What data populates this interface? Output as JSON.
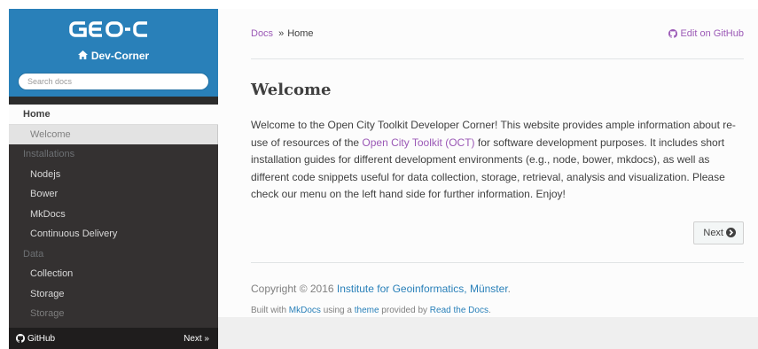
{
  "sidebar": {
    "logo_text": "GEO-C",
    "subtitle": "Dev-Corner",
    "search_placeholder": "Search docs",
    "items": [
      {
        "label": "Home"
      },
      {
        "label": "Welcome"
      },
      {
        "label": "Installations"
      },
      {
        "label": "Nodejs"
      },
      {
        "label": "Bower"
      },
      {
        "label": "MkDocs"
      },
      {
        "label": "Continuous Delivery"
      },
      {
        "label": "Data"
      },
      {
        "label": "Collection"
      },
      {
        "label": "Storage"
      },
      {
        "label": "Storage"
      }
    ],
    "footer": {
      "github_label": "GitHub",
      "next_label": "Next »"
    }
  },
  "breadcrumb": {
    "docs_label": "Docs",
    "separator": "»",
    "current": "Home",
    "edit_label": "Edit on GitHub"
  },
  "main": {
    "title": "Welcome",
    "para_1": "Welcome to the Open City Toolkit Developer Corner! This website provides ample information about re-use of resources of the ",
    "para_link": "Open City Toolkit (OCT)",
    "para_2": " for software development purposes. It includes short installation guides for different development environments (e.g., node, bower, mkdocs), as well as different code snippets useful for data collection, storage, retrieval, analysis and visualization. Please check our menu on the left hand side for further information. Enjoy!",
    "next_button": "Next"
  },
  "footer": {
    "copyright": "Copyright © 2016 ",
    "institute_link": "Institute for Geoinformatics, Münster",
    "period": ".",
    "built_1": "Built with ",
    "mkdocs_link": "MkDocs",
    "built_2": " using a ",
    "theme_link": "theme",
    "built_3": " provided by ",
    "rtd_link": "Read the Docs",
    "built_4": "."
  },
  "colors": {
    "accent": "#2980B9",
    "link": "#9B59B6",
    "sidebar_bg": "#343131"
  },
  "icons": [
    "home-icon",
    "github-icon",
    "arrow-circle-right-icon"
  ]
}
